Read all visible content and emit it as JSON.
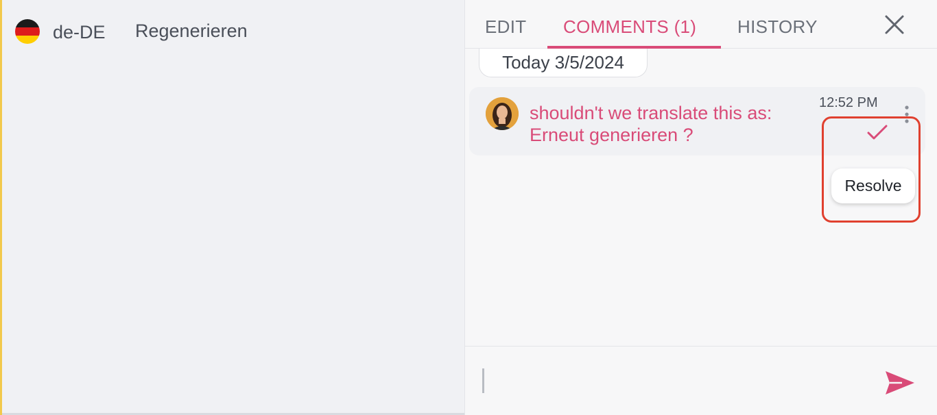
{
  "editor": {
    "language_code": "de-DE",
    "source_text": "Regenerieren",
    "flag_colors": [
      "#1b1b1b",
      "#dd1c1c",
      "#ffce00"
    ]
  },
  "panel": {
    "tabs": [
      {
        "label": "EDIT"
      },
      {
        "label": "COMMENTS (1)"
      },
      {
        "label": "HISTORY"
      }
    ],
    "active_tab_color": "#d94b78",
    "close_icon": "close-icon"
  },
  "comments": {
    "date_label": "Today 3/5/2024",
    "items": [
      {
        "text": "shouldn't we translate this as: Erneut generieren ?",
        "time": "12:52 PM",
        "resolve_label": "Resolve"
      }
    ],
    "input_placeholder": ""
  },
  "colors": {
    "accent": "#d94b78",
    "highlight": "#e0402f"
  }
}
